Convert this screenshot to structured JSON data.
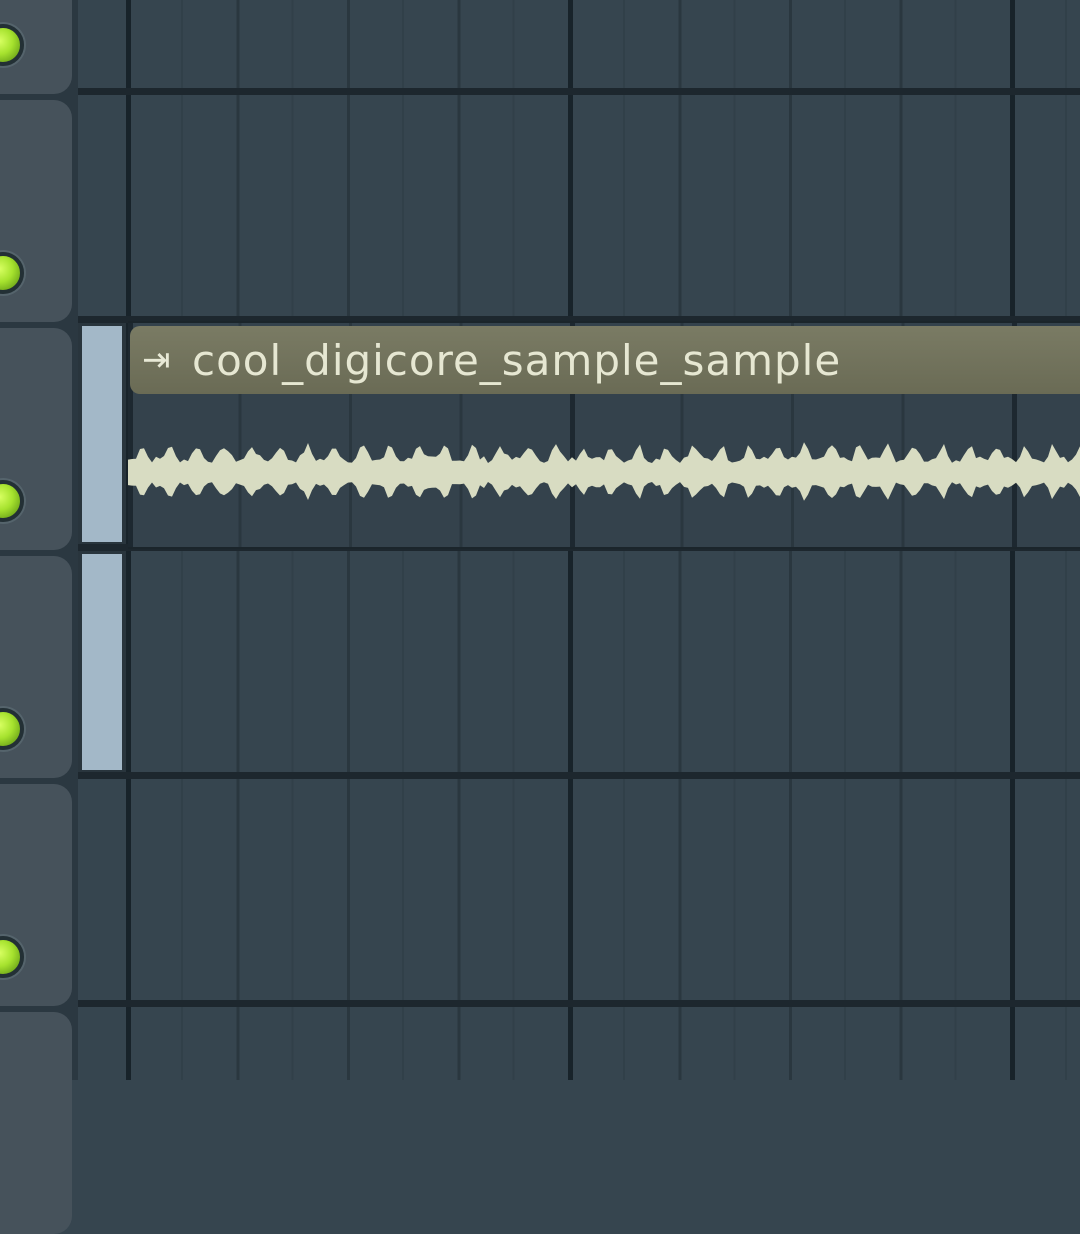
{
  "clip": {
    "title": "cool_digicore_sample_sample",
    "icon": "play-arrow-icon",
    "colors": {
      "header": "#6f705a",
      "waveform": "#d8dcc2"
    }
  },
  "tracks": [
    {
      "mute_led": "on"
    },
    {
      "mute_led": "on"
    },
    {
      "mute_led": "on"
    },
    {
      "mute_led": "on"
    },
    {
      "mute_led": "on"
    }
  ],
  "colors": {
    "grid_background": "#36454f",
    "led": "#a6e22e",
    "selection": "#a3b8c8"
  }
}
